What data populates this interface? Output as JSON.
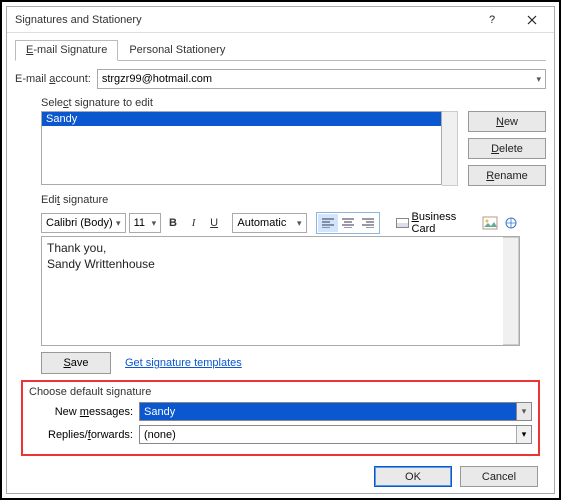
{
  "window": {
    "title": "Signatures and Stationery"
  },
  "tabs": {
    "email": "E-mail Signature",
    "stationery": "Personal Stationery"
  },
  "account": {
    "label": "E-mail account:",
    "value": "strgzr99@hotmail.com"
  },
  "select": {
    "label": "Select signature to edit",
    "items": [
      "Sandy"
    ]
  },
  "sidebtns": {
    "new": "New",
    "delete": "Delete",
    "rename": "Rename"
  },
  "edit": {
    "label": "Edit signature",
    "font": "Calibri (Body)",
    "size": "11",
    "b": "B",
    "i": "I",
    "u": "U",
    "color": "Automatic",
    "bizcard": "Business Card",
    "content": "Thank you,\nSandy Writtenhouse"
  },
  "save": {
    "btn": "Save",
    "link": "Get signature templates"
  },
  "defaults": {
    "title": "Choose default signature",
    "newmsg_label": "New messages:",
    "newmsg_value": "Sandy",
    "repfwd_label": "Replies/forwards:",
    "repfwd_value": "(none)"
  },
  "footer": {
    "ok": "OK",
    "cancel": "Cancel"
  }
}
